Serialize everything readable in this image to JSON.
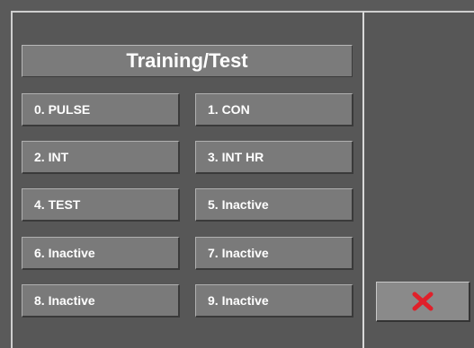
{
  "screen": {
    "title": "Training/Test"
  },
  "programs": [
    {
      "label": "0. PULSE"
    },
    {
      "label": "1. CON"
    },
    {
      "label": "2. INT"
    },
    {
      "label": "3. INT HR"
    },
    {
      "label": "4. TEST"
    },
    {
      "label": "5. Inactive"
    },
    {
      "label": "6. Inactive"
    },
    {
      "label": "7. Inactive"
    },
    {
      "label": "8. Inactive"
    },
    {
      "label": "9. Inactive"
    }
  ],
  "close_button": {
    "icon": "close-icon",
    "icon_color": "#e0202a"
  }
}
